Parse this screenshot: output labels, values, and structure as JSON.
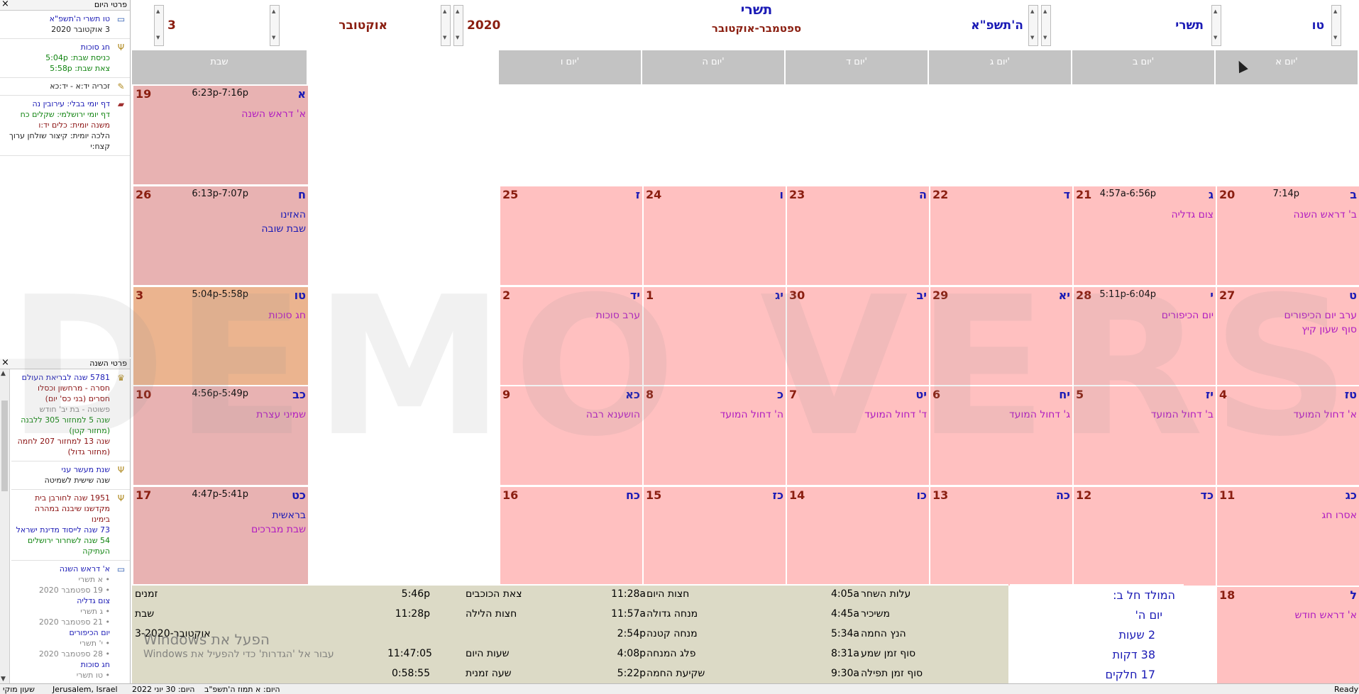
{
  "daily_panel": {
    "title": "פרטי היום",
    "entries": [
      {
        "icon": "calendar-icon",
        "lines": [
          {
            "text": "טו תשרי ה'תשפ\"א",
            "c": "blue"
          },
          {
            "text": "3 אוקטובר 2020",
            "c": "dk"
          }
        ]
      },
      {
        "icon": "menorah-icon",
        "lines": [
          {
            "text": "חג סוכות",
            "c": "blue"
          },
          {
            "text": "כניסת שבת: 5:04p",
            "c": "green"
          },
          {
            "text": "צאת שבת: 5:58p",
            "c": "green"
          }
        ]
      },
      {
        "icon": "yahrzeit-icon",
        "lines": [
          {
            "text": "זכריה יד:א - יד:כא",
            "c": "dk"
          }
        ]
      },
      {
        "icon": "book-icon",
        "lines": [
          {
            "text": "דף יומי בבלי: עירובין נה",
            "c": "blue"
          },
          {
            "text": "דף יומי ירושלמי: שקלים כח",
            "c": "green"
          },
          {
            "text": "משנה יומית: כלים יד:ו",
            "c": "dred"
          },
          {
            "text": "הלכה יומית: קיצור שולחן ערוך קצח:י",
            "c": "dk"
          }
        ]
      }
    ]
  },
  "year_panel": {
    "title": "פרטי השנה",
    "entries": [
      {
        "icon": "crown-icon",
        "lines": [
          {
            "text": "5781 שנה לבריאת העולם",
            "c": "blue"
          },
          {
            "text": "חסרה - מרחשון וכסלו חסרים (בני כס' יום)",
            "c": "dred"
          },
          {
            "text": "פשוטה - בת יב' חודש",
            "c": "gray"
          },
          {
            "text": "שנה 5 למחזור 305 ללבנה (מחזור קטן)",
            "c": "green"
          },
          {
            "text": "שנה 13 למחזור 207 לחמה (מחזור גדול)",
            "c": "dred"
          }
        ]
      },
      {
        "icon": "menorah-icon",
        "lines": [
          {
            "text": "שנת מעשר עני",
            "c": "blue"
          },
          {
            "text": "שנה שישית לשמיטה",
            "c": "dk"
          }
        ]
      },
      {
        "icon": "menorah-icon",
        "lines": [
          {
            "text": "1951 שנה לחורבן בית מקדשנו שיבנה במהרה בימינו",
            "c": "dred"
          },
          {
            "text": "73 שנה לייסוד מדינת ישראל",
            "c": "blue"
          },
          {
            "text": "54 שנה לשחרור ירושלים העתיקה",
            "c": "green"
          }
        ]
      },
      {
        "icon": "calendar-icon",
        "lines": [
          {
            "text": "א' דראש השנה",
            "c": "blue"
          },
          {
            "text": "• א תשרי",
            "c": "gray"
          },
          {
            "text": "• 19 ספטמבר 2020",
            "c": "gray"
          },
          {
            "text": "צום גדליה",
            "c": "blue"
          },
          {
            "text": "• ג תשרי",
            "c": "gray"
          },
          {
            "text": "• 21 ספטמבר 2020",
            "c": "gray"
          },
          {
            "text": "יום הכיפורים",
            "c": "blue"
          },
          {
            "text": "• י' תשרי",
            "c": "gray"
          },
          {
            "text": "• 28 ספטמבר 2020",
            "c": "gray"
          },
          {
            "text": "חג סוכות",
            "c": "blue"
          },
          {
            "text": "• טו תשרי",
            "c": "gray"
          }
        ]
      }
    ]
  },
  "header": {
    "h_day": "טו",
    "h_month": "תשרי",
    "h_year": "ה'תשפ\"א",
    "g_year": "2020",
    "g_month": "אוקטובר",
    "g_day": "3",
    "month_title": "תשרי",
    "month_sub": "ספטמבר-אוקטובר"
  },
  "day_headers": [
    "יום א'",
    "יום ב'",
    "יום ג'",
    "יום ד'",
    "יום ה'",
    "יום ו'",
    "שבת"
  ],
  "weeks": [
    [
      null,
      null,
      null,
      null,
      null,
      null,
      {
        "h": "א",
        "g": "19",
        "t": "6:23p-7:16p",
        "ev": [
          {
            "text": "א' דראש השנה",
            "c": "mag"
          }
        ]
      }
    ],
    [
      {
        "h": "ב",
        "g": "20",
        "t": "7:14p",
        "ev": [
          {
            "text": "ב' דראש השנה",
            "c": "mag"
          }
        ]
      },
      {
        "h": "ג",
        "g": "21",
        "t": "4:57a-6:56p",
        "ev": [
          {
            "text": "צום גדליה",
            "c": "mag"
          }
        ]
      },
      {
        "h": "ד",
        "g": "22",
        "ev": []
      },
      {
        "h": "ה",
        "g": "23",
        "ev": []
      },
      {
        "h": "ו",
        "g": "24",
        "ev": []
      },
      {
        "h": "ז",
        "g": "25",
        "ev": []
      },
      {
        "h": "ח",
        "g": "26",
        "t": "6:13p-7:07p",
        "ev": [
          {
            "text": "האזינו",
            "c": "blue"
          },
          {
            "text": "שבת שובה",
            "c": "blue"
          }
        ]
      }
    ],
    [
      {
        "h": "ט",
        "g": "27",
        "ev": [
          {
            "text": "ערב יום הכיפורים",
            "c": "mag"
          },
          {
            "text": "סוף שעון קיץ",
            "c": "mag"
          }
        ]
      },
      {
        "h": "י",
        "g": "28",
        "t": "5:11p-6:04p",
        "ev": [
          {
            "text": "יום הכיפורים",
            "c": "mag"
          }
        ]
      },
      {
        "h": "יא",
        "g": "29",
        "ev": []
      },
      {
        "h": "יב",
        "g": "30",
        "ev": []
      },
      {
        "h": "יג",
        "g": "1",
        "ev": []
      },
      {
        "h": "יד",
        "g": "2",
        "ev": [
          {
            "text": "ערב סוכות",
            "c": "mag"
          }
        ]
      },
      {
        "h": "טו",
        "g": "3",
        "t": "5:04p-5:58p",
        "ev": [
          {
            "text": "חג סוכות",
            "c": "mag"
          }
        ],
        "sel": true
      }
    ],
    [
      {
        "h": "טז",
        "g": "4",
        "ev": [
          {
            "text": "א' דחול המועד",
            "c": "mag"
          }
        ]
      },
      {
        "h": "יז",
        "g": "5",
        "ev": [
          {
            "text": "ב' דחול המועד",
            "c": "mag"
          }
        ]
      },
      {
        "h": "יח",
        "g": "6",
        "ev": [
          {
            "text": "ג' דחול המועד",
            "c": "mag"
          }
        ]
      },
      {
        "h": "יט",
        "g": "7",
        "ev": [
          {
            "text": "ד' דחול המועד",
            "c": "mag"
          }
        ]
      },
      {
        "h": "כ",
        "g": "8",
        "ev": [
          {
            "text": "ה' דחול המועד",
            "c": "mag"
          }
        ]
      },
      {
        "h": "כא",
        "g": "9",
        "ev": [
          {
            "text": "הושענא רבה",
            "c": "mag"
          }
        ]
      },
      {
        "h": "כב",
        "g": "10",
        "t": "4:56p-5:49p",
        "ev": [
          {
            "text": "שמיני עצרת",
            "c": "mag"
          }
        ]
      }
    ],
    [
      {
        "h": "כג",
        "g": "11",
        "ev": [
          {
            "text": "אסרו חג",
            "c": "mag"
          }
        ]
      },
      {
        "h": "כד",
        "g": "12",
        "ev": []
      },
      {
        "h": "כה",
        "g": "13",
        "ev": []
      },
      {
        "h": "כו",
        "g": "14",
        "ev": []
      },
      {
        "h": "כז",
        "g": "15",
        "ev": []
      },
      {
        "h": "כח",
        "g": "16",
        "ev": []
      },
      {
        "h": "כט",
        "g": "17",
        "t": "4:47p-5:41p",
        "ev": [
          {
            "text": "בראשית",
            "c": "blue"
          },
          {
            "text": "שבת מברכים",
            "c": "mag"
          }
        ]
      }
    ],
    [
      {
        "h": "ל",
        "g": "18",
        "ev": [
          {
            "text": "א' דראש חודש",
            "c": "mag"
          }
        ]
      }
    ]
  ],
  "zmanim": {
    "title": "זמנים",
    "sub1": "שבת",
    "sub2": "3-אוקטובר-2020",
    "col1": [
      {
        "l": "עלות השחר",
        "v": "4:05a"
      },
      {
        "l": "משיכיר",
        "v": "4:45a"
      },
      {
        "l": "הנץ החמה",
        "v": "5:34a"
      },
      {
        "l": "סוף זמן שמע",
        "v": "8:31a"
      },
      {
        "l": "סוף זמן תפילה",
        "v": "9:30a"
      }
    ],
    "col2": [
      {
        "l": "חצות היום",
        "v": "11:28a"
      },
      {
        "l": "מנחה גדולה",
        "v": "11:57a"
      },
      {
        "l": "מנחה קטנה",
        "v": "2:54p"
      },
      {
        "l": "פלג המנחה",
        "v": "4:08p"
      },
      {
        "l": "שקיעת החמה",
        "v": "5:22p"
      }
    ],
    "col3": [
      {
        "l": "צאת הכוכבים",
        "v": "5:46p"
      },
      {
        "l": "חצות הלילה",
        "v": "11:28p"
      },
      {
        "l": "",
        "v": ""
      },
      {
        "l": "שעות היום",
        "v": "11:47:05"
      },
      {
        "l": "שעה זמנית",
        "v": "0:58:55"
      }
    ]
  },
  "molad": {
    "title": "המולד חל ב:",
    "day": "יום ה'",
    "hours": "2 שעות",
    "minutes": "38 דקות",
    "parts": "17 חלקים"
  },
  "status_bar": {
    "a": "שעון מוקי",
    "b": "Jerusalem, Israel",
    "c": "היום: 30 יוני 2022",
    "d": "היום: א תמוז ה'תשפ\"ב",
    "e": "Ready"
  },
  "watermark": "DEMO VERSION",
  "activation": {
    "title": "הפעל את Windows",
    "sub": "עבור אל 'הגדרות' כדי להפעיל את Windows"
  }
}
